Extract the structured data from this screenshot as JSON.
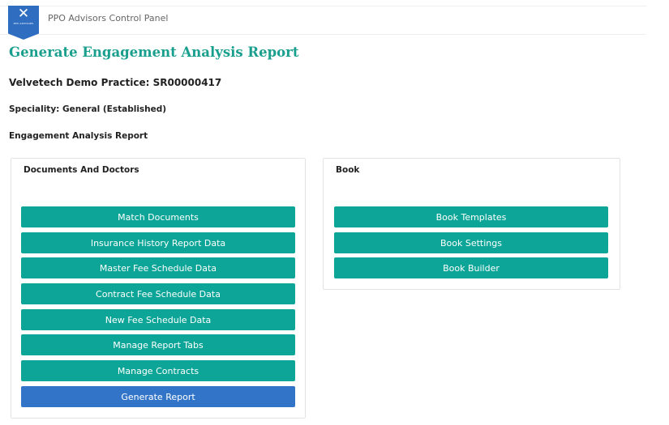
{
  "header": {
    "logo_text": "PPO ADVISORS",
    "app_title": "PPO Advisors Control Panel",
    "brand_color": "#2f6dc0"
  },
  "page": {
    "title": "Generate Engagement Analysis Report",
    "practice": "Velvetech Demo Practice: SR00000417",
    "speciality": "Speciality: General (Established)",
    "report_label": "Engagement Analysis Report"
  },
  "documents_panel": {
    "title": "Documents And Doctors",
    "buttons": [
      "Match Documents",
      "Insurance History Report Data",
      "Master Fee Schedule Data",
      "Contract Fee Schedule Data",
      "New Fee Schedule Data",
      "Manage Report Tabs",
      "Manage Contracts",
      "Generate Report"
    ]
  },
  "book_panel": {
    "title": "Book",
    "buttons": [
      "Book Templates",
      "Book Settings",
      "Book Builder"
    ]
  },
  "colors": {
    "teal": "#0ca597",
    "blue": "#3275c8",
    "title": "#1a9f8f"
  }
}
